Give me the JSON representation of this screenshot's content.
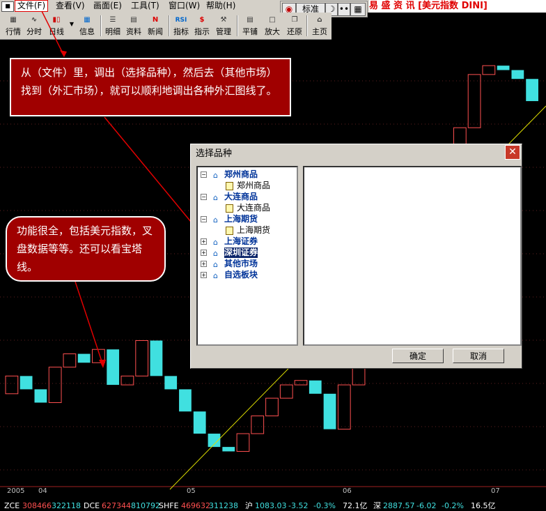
{
  "menubar": {
    "app_icon": "chart-window-icon",
    "items": [
      "文件(F)",
      "查看(V)",
      "画面(E)",
      "工具(T)",
      "窗口(W)",
      "帮助(H)"
    ],
    "title": "易 盛 资 讯 [美元指数 DINI]"
  },
  "zoom": {
    "label": "标准"
  },
  "toolbar": {
    "buttons": [
      "行情",
      "分时",
      "日线",
      "信息",
      "明细",
      "资料",
      "新闻",
      "指标",
      "指示",
      "管理",
      "平铺",
      "放大",
      "还原",
      "主页"
    ],
    "icon_glyphs": {
      "rsi": "RSI",
      "news": "N",
      "indicator": "$"
    }
  },
  "callouts": {
    "first": "从（文件）里，调出（选择品种），然后去（其他市场）找到（外汇市场），就可以顺利地调出各种外汇图线了。",
    "second": "功能很全，包括美元指数，叉盘数据等等。还可以看宝塔线。"
  },
  "dialog": {
    "title": "选择品种",
    "tree": [
      {
        "label": "郑州商品",
        "children": [
          "郑州商品"
        ]
      },
      {
        "label": "大连商品",
        "children": [
          "大连商品"
        ]
      },
      {
        "label": "上海期货",
        "children": [
          "上海期货"
        ]
      },
      {
        "label": "上海证券",
        "children": []
      },
      {
        "label": "深圳证券",
        "children": [],
        "selected": true
      },
      {
        "label": "其他市场",
        "children": []
      },
      {
        "label": "自选板块",
        "children": []
      }
    ],
    "ok_label": "确定",
    "cancel_label": "取消"
  },
  "x_axis": {
    "labels": [
      "2005",
      "04",
      "05",
      "06",
      "07"
    ]
  },
  "status": {
    "zce_label": "ZCE",
    "zce_v1": "308466",
    "zce_v2": "322118",
    "dce_label": "DCE",
    "dce_v1": "627344",
    "dce_v2": "810792",
    "shfe_label": "SHFE",
    "shfe_v1": "469632",
    "shfe_v2": "311238",
    "sh_label": "沪",
    "sh_index": "1083.03",
    "sh_change": "-3.52",
    "sh_pct": "-0.3%",
    "sh_amount": "72.1亿",
    "sz_label": "深",
    "sz_index": "2887.57",
    "sz_change": "-6.02",
    "sz_pct": "-0.2%",
    "sz_amount": "16.5亿"
  },
  "colors": {
    "up": "#ff5050",
    "down": "#40e0e0",
    "trend": "#e0e000",
    "callout": "#a00000"
  },
  "chart_data": {
    "type": "candlestick",
    "description_series": "tower line (宝塔线) bars, up = red hollow, down = cyan filled",
    "bars": [
      {
        "o": 1.0,
        "c": 1.2,
        "up": true
      },
      {
        "o": 1.2,
        "c": 1.05,
        "up": false
      },
      {
        "o": 1.05,
        "c": 0.9,
        "up": false
      },
      {
        "o": 0.9,
        "c": 1.3,
        "up": true
      },
      {
        "o": 1.3,
        "c": 1.45,
        "up": true
      },
      {
        "o": 1.45,
        "c": 1.35,
        "up": false
      },
      {
        "o": 1.35,
        "c": 1.5,
        "up": true
      },
      {
        "o": 1.5,
        "c": 1.1,
        "up": false
      },
      {
        "o": 1.1,
        "c": 1.2,
        "up": true
      },
      {
        "o": 1.2,
        "c": 1.6,
        "up": true
      },
      {
        "o": 1.6,
        "c": 1.2,
        "up": false
      },
      {
        "o": 1.2,
        "c": 1.05,
        "up": false
      },
      {
        "o": 1.05,
        "c": 0.8,
        "up": false
      },
      {
        "o": 0.8,
        "c": 0.55,
        "up": false
      },
      {
        "o": 0.55,
        "c": 0.4,
        "up": false
      },
      {
        "o": 0.4,
        "c": 0.35,
        "up": false
      },
      {
        "o": 0.35,
        "c": 0.55,
        "up": true
      },
      {
        "o": 0.55,
        "c": 0.75,
        "up": true
      },
      {
        "o": 0.75,
        "c": 0.95,
        "up": true
      },
      {
        "o": 0.95,
        "c": 1.1,
        "up": true
      },
      {
        "o": 1.1,
        "c": 1.15,
        "up": true
      },
      {
        "o": 1.15,
        "c": 1.0,
        "up": false
      },
      {
        "o": 1.0,
        "c": 0.6,
        "up": false
      },
      {
        "o": 0.6,
        "c": 1.1,
        "up": true
      },
      {
        "o": 1.1,
        "c": 1.3,
        "up": true
      },
      {
        "o": 1.3,
        "c": 1.5,
        "up": true
      },
      {
        "o": 1.5,
        "c": 1.9,
        "up": true
      },
      {
        "o": 3.6,
        "c": 3.4,
        "up": false
      },
      {
        "o": 3.4,
        "c": 3.55,
        "up": true
      },
      {
        "o": 3.55,
        "c": 3.7,
        "up": true
      },
      {
        "o": 3.7,
        "c": 3.6,
        "up": false
      },
      {
        "o": 3.6,
        "c": 4.0,
        "up": true
      },
      {
        "o": 4.0,
        "c": 4.6,
        "up": true
      },
      {
        "o": 4.6,
        "c": 4.7,
        "up": true
      },
      {
        "o": 4.7,
        "c": 4.65,
        "up": false
      },
      {
        "o": 4.65,
        "c": 4.55,
        "up": false
      },
      {
        "o": 4.55,
        "c": 4.3,
        "up": false
      }
    ]
  }
}
